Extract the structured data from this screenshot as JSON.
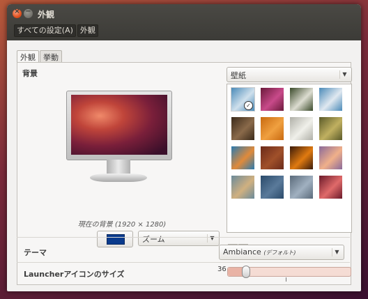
{
  "window": {
    "title": "外観",
    "toolbar": {
      "all_settings": "すべての設定(A)",
      "current": "外観"
    }
  },
  "tabs": [
    {
      "label": "外観",
      "active": true
    },
    {
      "label": "挙動",
      "active": false
    }
  ],
  "background": {
    "label": "背景",
    "current_label": "現在の背景 (1920 × 1280)",
    "color_swatch": "#0a3a8c",
    "mode_combo": "ズーム",
    "source_combo": "壁紙"
  },
  "wallpapers": [
    {
      "id": "w1",
      "colors": [
        "#4a8ab8",
        "#cfe0ec"
      ],
      "selected": true
    },
    {
      "id": "w2",
      "colors": [
        "#6a1a3a",
        "#c84a8a"
      ]
    },
    {
      "id": "w3",
      "colors": [
        "#3a4a2a",
        "#dcdcd0"
      ]
    },
    {
      "id": "w4",
      "colors": [
        "#4a8ab8",
        "#e0e8f0"
      ]
    },
    {
      "id": "w5",
      "colors": [
        "#3a2a1a",
        "#8a6a4a"
      ]
    },
    {
      "id": "w6",
      "colors": [
        "#c86a10",
        "#f0a040"
      ]
    },
    {
      "id": "w7",
      "colors": [
        "#b0b0a8",
        "#f0f0ea"
      ]
    },
    {
      "id": "w8",
      "colors": [
        "#5a5a2a",
        "#c0b060"
      ]
    },
    {
      "id": "w9",
      "colors": [
        "#2a7ab0",
        "#e08a3a"
      ]
    },
    {
      "id": "w10",
      "colors": [
        "#6a2a1a",
        "#a0502a"
      ]
    },
    {
      "id": "w11",
      "colors": [
        "#3a1a0a",
        "#e07a10"
      ]
    },
    {
      "id": "w12",
      "colors": [
        "#8a6a9a",
        "#f0b08a"
      ]
    },
    {
      "id": "w13",
      "colors": [
        "#6a8a9a",
        "#d0b080"
      ]
    },
    {
      "id": "w14",
      "colors": [
        "#2a4a6a",
        "#5a7a9a"
      ]
    },
    {
      "id": "w15",
      "colors": [
        "#5a6a7a",
        "#a0b0c0"
      ]
    },
    {
      "id": "w16",
      "colors": [
        "#6a1a2a",
        "#e06a6a"
      ]
    }
  ],
  "wallpaper_controls": {
    "add": "+",
    "remove": "−"
  },
  "theme": {
    "label": "テーマ",
    "value": "Ambiance",
    "note": "(デフォルト)"
  },
  "launcher": {
    "label": "Launcherアイコンのサイズ",
    "value": "36",
    "slider_fraction": 0.14
  }
}
